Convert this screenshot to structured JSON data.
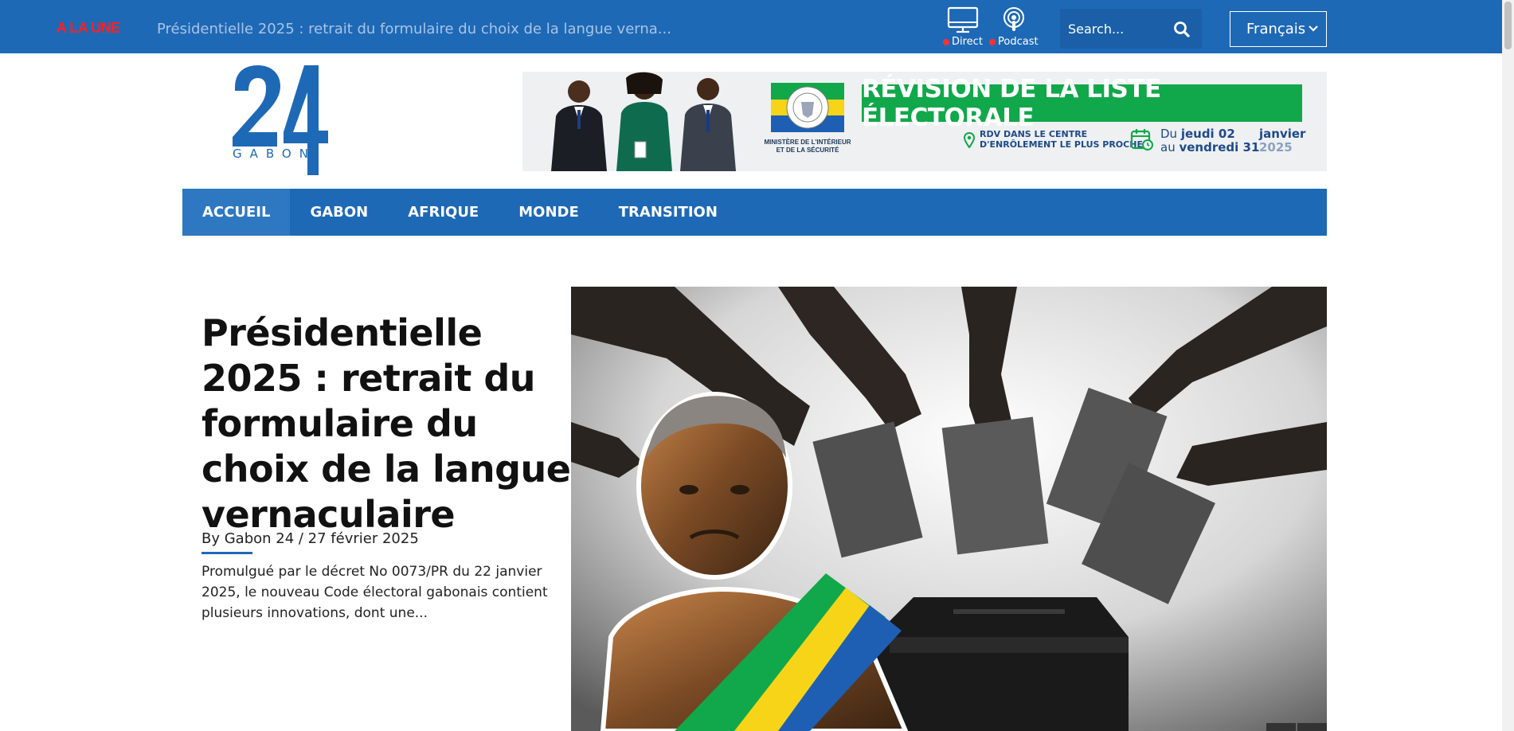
{
  "topbar": {
    "breaking_label": "A LA UNE",
    "ticker_text": "Présidentielle 2025 : retrait du formulaire du choix de la langue verna...",
    "direct_label": "Direct",
    "podcast_label": "Podcast",
    "search_placeholder": "Search...",
    "language": "Français"
  },
  "logo": {
    "number": "24",
    "name": "GABON"
  },
  "banner": {
    "headline": "RÉVISION DE LA LISTE ÉLECTORALE",
    "ministry": "MINISTÈRE DE L'INTÉRIEUR ET DE LA SÉCURITÉ",
    "rdv_line1": "RDV DANS LE CENTRE",
    "rdv_line2": "D'ENRÔLEMENT LE PLUS PROCHE",
    "date_line1_prefix": "Du ",
    "date_line1_bold": "jeudi 02",
    "date_line2_prefix": "au ",
    "date_line2_bold": "vendredi 31",
    "month": "janvier",
    "year": "2025"
  },
  "nav": {
    "items": [
      {
        "label": "ACCUEIL"
      },
      {
        "label": "GABON"
      },
      {
        "label": "AFRIQUE"
      },
      {
        "label": "MONDE"
      },
      {
        "label": "TRANSITION"
      }
    ]
  },
  "article": {
    "title": "Présidentielle 2025 : retrait du formulaire du choix de la langue vernaculaire",
    "byline": "By Gabon 24 / 27 février 2025",
    "excerpt": "Promulgué par le décret No 0073/PR du 22 janvier 2025, le nouveau Code électoral gabonais contient plusieurs innovations, dont une..."
  },
  "colors": {
    "brand_blue": "#1e69b6",
    "breaking_red": "#ff2020",
    "banner_green": "#10a84a"
  }
}
